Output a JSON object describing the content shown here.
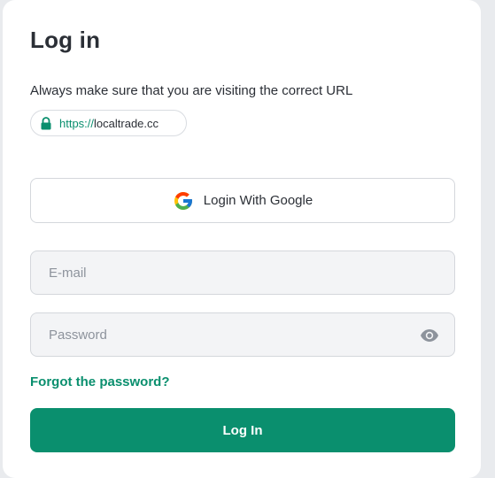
{
  "login": {
    "title": "Log in",
    "notice": "Always make sure that you are visiting the correct URL",
    "url": {
      "scheme": "https://",
      "host": "localtrade.cc"
    },
    "google_button_label": "Login With Google",
    "email": {
      "placeholder": "E-mail",
      "value": ""
    },
    "password": {
      "placeholder": "Password",
      "value": ""
    },
    "forgot_link": "Forgot the password?",
    "submit_label": "Log In"
  },
  "colors": {
    "accent": "#0a8f6e",
    "text": "#2b2f36",
    "field_bg": "#f3f4f6",
    "border": "#d4d7dc"
  },
  "icons": [
    "lock-icon",
    "google-icon",
    "eye-icon"
  ]
}
